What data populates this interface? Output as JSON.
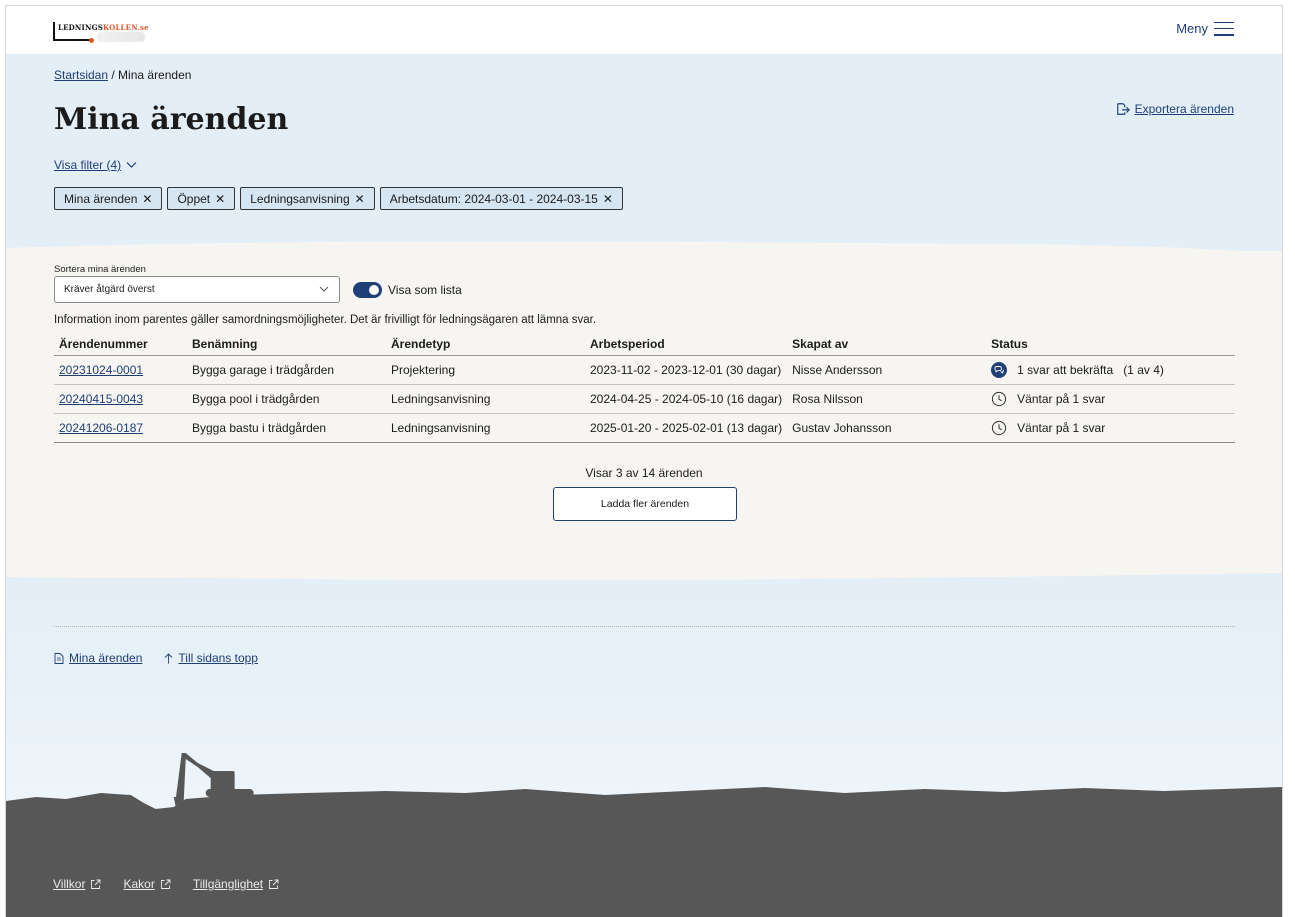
{
  "header": {
    "logo": "LEDNINGSKOLLEN.se",
    "menu_label": "Meny"
  },
  "hero": {
    "breadcrumb": {
      "home": "Startsidan",
      "separator": " / ",
      "current": "Mina ärenden"
    },
    "title": "Mina ärenden",
    "export_label": "Exportera ärenden",
    "filter_toggle": "Visa filter (4)",
    "chips": [
      "Mina ärenden",
      "Öppet",
      "Ledningsanvisning",
      "Arbetsdatum: 2024-03-01 - 2024-03-15"
    ]
  },
  "main": {
    "sort_label": "Sortera mina ärenden",
    "sort_value": "Kräver åtgärd överst",
    "list_toggle_label": "Visa som lista",
    "info_text": "Information inom parentes gäller samordningsmöjligheter. Det är frivilligt för ledningsägaren att lämna svar.",
    "columns": [
      "Ärendenummer",
      "Benämning",
      "Ärendetyp",
      "Arbetsperiod",
      "Skapat av",
      "Status"
    ],
    "rows": [
      {
        "id": "20231024-0001",
        "name": "Bygga garage i trädgården",
        "type": "Projektering",
        "period": "2023-11-02 - 2023-12-01 (30 dagar)",
        "created_by": "Nisse Andersson",
        "status": "1 svar att bekräfta",
        "status_extra": "(1 av 4)",
        "status_icon": "chat-bubble-icon"
      },
      {
        "id": "20240415-0043",
        "name": "Bygga pool i trädgården",
        "type": "Ledningsanvisning",
        "period": "2024-04-25 - 2024-05-10 (16 dagar)",
        "created_by": "Rosa Nilsson",
        "status": "Väntar på 1 svar",
        "status_extra": "",
        "status_icon": "clock-icon"
      },
      {
        "id": "20241206-0187",
        "name": "Bygga bastu i trädgården",
        "type": "Ledningsanvisning",
        "period": "2025-01-20 - 2025-02-01 (13 dagar)",
        "created_by": "Gustav Johansson",
        "status": "Väntar på 1 svar",
        "status_extra": "",
        "status_icon": "clock-icon"
      }
    ],
    "showing": "Visar 3 av 14 ärenden",
    "load_more": "Ladda fler ärenden"
  },
  "footer": {
    "links": [
      "Mina ärenden",
      "Till sidans topp"
    ],
    "legal": [
      "Villkor",
      "Kakor",
      "Tillgänglighet"
    ]
  },
  "colors": {
    "brand_blue": "#1f3f77",
    "hero_bg": "#e3eef6",
    "main_bg": "#f7f5f2",
    "ground": "#575757",
    "logo_accent": "#e0572a"
  }
}
